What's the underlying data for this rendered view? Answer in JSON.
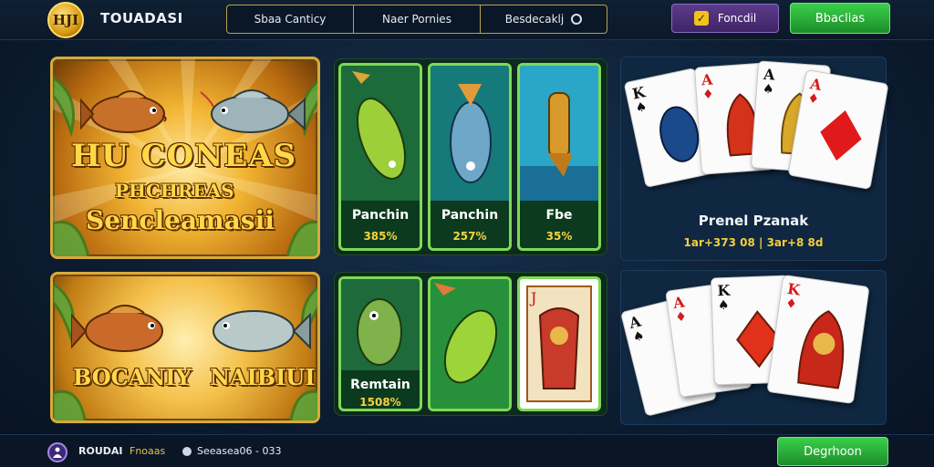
{
  "header": {
    "logo_text": "HJI",
    "brand": "TOUADASI",
    "nav": [
      {
        "label": "Sbaa Canticy"
      },
      {
        "label": "Naer Pornies"
      },
      {
        "label": "Besdecaklj"
      }
    ],
    "secondary_button": "Foncdil",
    "primary_button": "Bbaclias"
  },
  "promos": [
    {
      "title": "HU CONEAS",
      "subtitle": "PHCHREAS",
      "tagline": "Sencleamasii"
    },
    {
      "left_word": "BOCANIY",
      "right_word": "NAIBIUI"
    }
  ],
  "game_tiles_row1": [
    {
      "label": "Panchin",
      "pct": "385%"
    },
    {
      "label": "Panchin",
      "pct": "257%"
    },
    {
      "label": "Fbe",
      "pct": "35%"
    }
  ],
  "game_tiles_row2": [
    {
      "label": "Remtain",
      "pct": "1508%"
    }
  ],
  "card_panel": {
    "title": "Prenel Pzanak",
    "odds": "1ar+373 08 | 3ar+8 8d",
    "cards_top": [
      {
        "rank": "K",
        "suit": "♠",
        "color": "black"
      },
      {
        "rank": "A",
        "suit": "♦",
        "color": "red"
      },
      {
        "rank": "A",
        "suit": "♠",
        "color": "black"
      },
      {
        "rank": "A",
        "suit": "♦",
        "color": "red"
      }
    ],
    "cards_bottom": [
      {
        "rank": "A",
        "suit": "♠",
        "color": "black"
      },
      {
        "rank": "A",
        "suit": "♦",
        "color": "red"
      },
      {
        "rank": "K",
        "suit": "♠",
        "color": "black"
      },
      {
        "rank": "K",
        "suit": "♦",
        "color": "red"
      }
    ]
  },
  "footer": {
    "username": "ROUDAI",
    "status": "Fnoaas",
    "balance": "Seeasea06 - 033",
    "action_button": "Degrhoon"
  },
  "colors": {
    "accent_green": "#3bcf4a",
    "accent_gold": "#f3cf3a",
    "accent_purple": "#5d3b8a",
    "background": "#0c1c30"
  }
}
